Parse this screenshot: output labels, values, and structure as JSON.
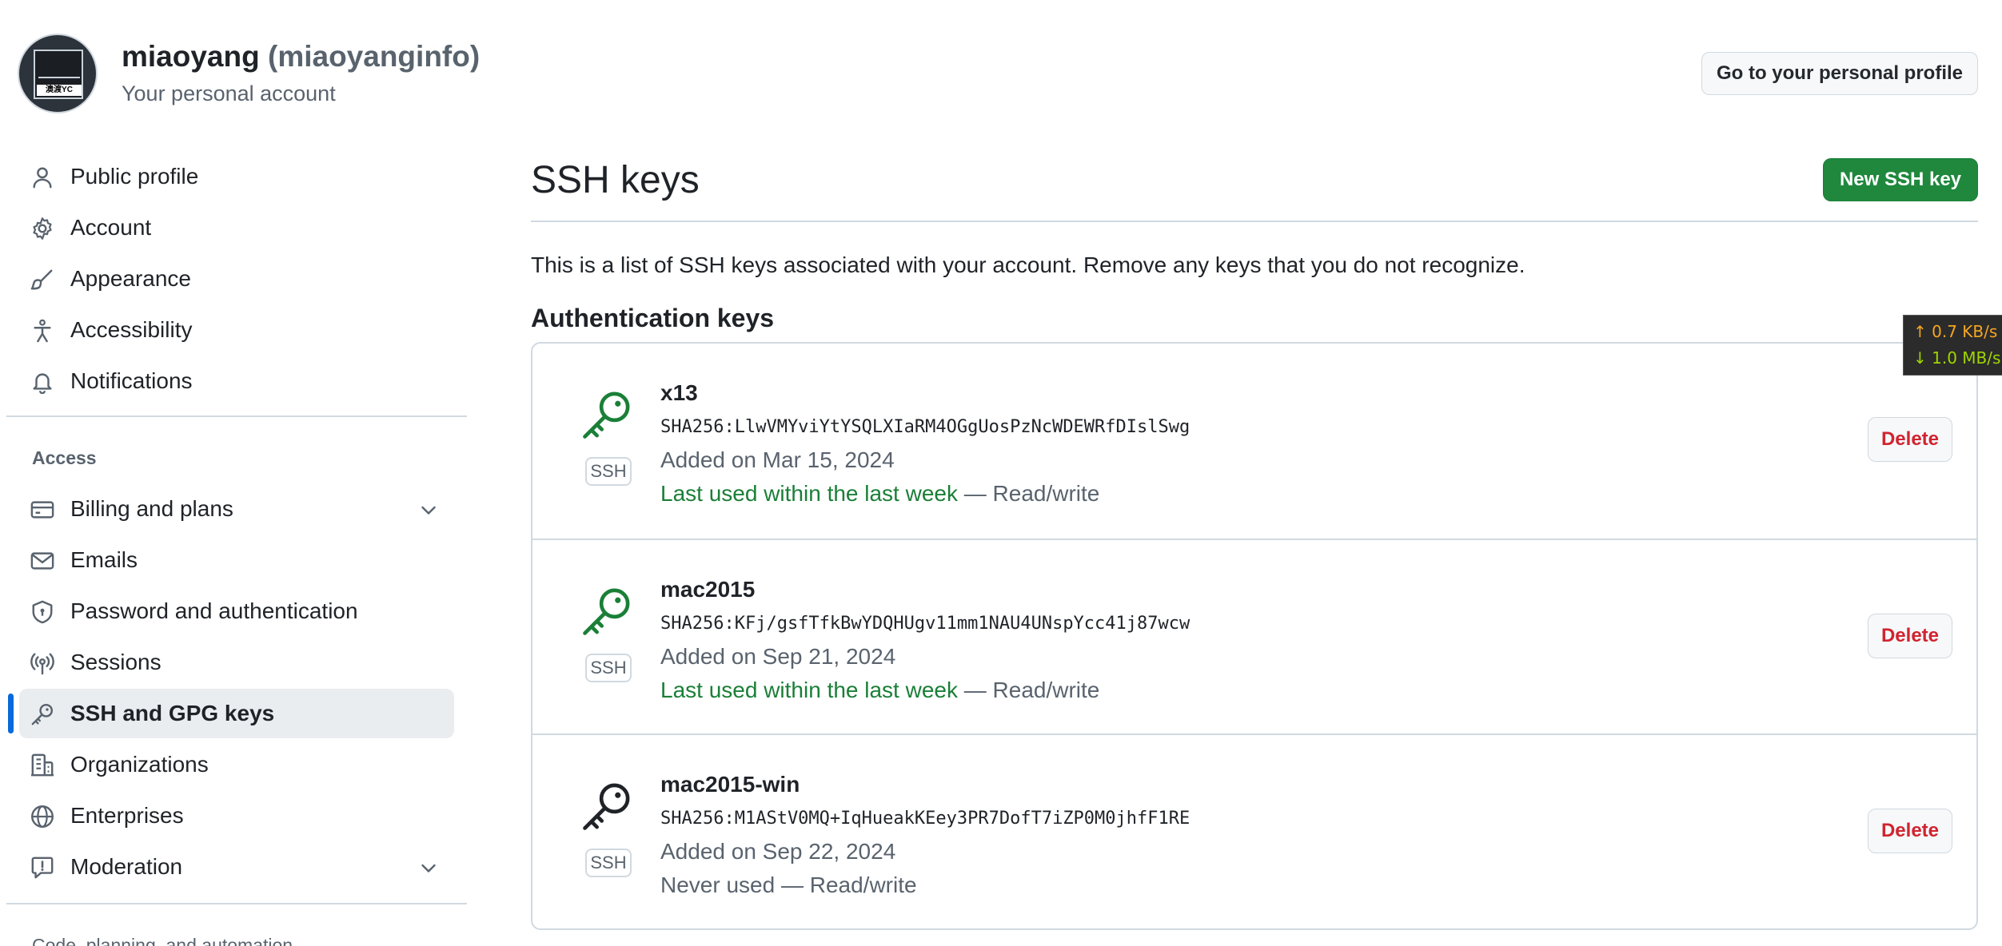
{
  "header": {
    "name": "miaoyang",
    "handle": "(miaoyanginfo)",
    "subtitle": "Your personal account",
    "avatar_text": "澳渡YC",
    "profile_button": "Go to your personal profile"
  },
  "sidebar": {
    "items": [
      {
        "label": "Public profile",
        "icon": "person-icon"
      },
      {
        "label": "Account",
        "icon": "gear-icon"
      },
      {
        "label": "Appearance",
        "icon": "paintbrush-icon"
      },
      {
        "label": "Accessibility",
        "icon": "accessibility-icon"
      },
      {
        "label": "Notifications",
        "icon": "bell-icon"
      }
    ],
    "access_heading": "Access",
    "access_items": [
      {
        "label": "Billing and plans",
        "icon": "credit-card-icon",
        "expandable": true
      },
      {
        "label": "Emails",
        "icon": "mail-icon"
      },
      {
        "label": "Password and authentication",
        "icon": "shield-lock-icon"
      },
      {
        "label": "Sessions",
        "icon": "broadcast-icon"
      },
      {
        "label": "SSH and GPG keys",
        "icon": "key-icon",
        "active": true
      },
      {
        "label": "Organizations",
        "icon": "organization-icon"
      },
      {
        "label": "Enterprises",
        "icon": "globe-icon"
      },
      {
        "label": "Moderation",
        "icon": "report-icon",
        "expandable": true
      }
    ],
    "next_heading": "Code, planning, and automation"
  },
  "main": {
    "title": "SSH keys",
    "new_button": "New SSH key",
    "description": "This is a list of SSH keys associated with your account. Remove any keys that you do not recognize.",
    "auth_heading": "Authentication keys",
    "keys": [
      {
        "name": "x13",
        "fingerprint": "SHA256:LlwVMYviYtYSQLXIaRM4OGgUosPzNcWDEWRfDIslSwg",
        "added": "Added on Mar 15, 2024",
        "usage_recent": "Last used within the last week",
        "usage_suffix": " — Read/write",
        "badge": "SSH",
        "icon_color": "#1a7f37",
        "delete": "Delete"
      },
      {
        "name": "mac2015",
        "fingerprint": "SHA256:KFj/gsfTfkBwYDQHUgv11mm1NAU4UNspYcc41j87wcw",
        "added": "Added on Sep 21, 2024",
        "usage_recent": "Last used within the last week",
        "usage_suffix": " — Read/write",
        "badge": "SSH",
        "icon_color": "#1a7f37",
        "delete": "Delete"
      },
      {
        "name": "mac2015-win",
        "fingerprint": "SHA256:M1AStV0MQ+IqHueakKEey3PR7DofT7iZP0M0jhfF1RE",
        "added": "Added on Sep 22, 2024",
        "usage_recent": "",
        "usage_suffix": "Never used — Read/write",
        "badge": "SSH",
        "icon_color": "#1f2328",
        "delete": "Delete"
      }
    ]
  },
  "network_overlay": {
    "upload": "↑ 0.7 KB/s",
    "download": "↓ 1.0 MB/s"
  },
  "colors": {
    "accent": "#0969da",
    "primary_button": "#1f883d",
    "danger": "#d1242f",
    "success_text": "#1a7f37"
  }
}
